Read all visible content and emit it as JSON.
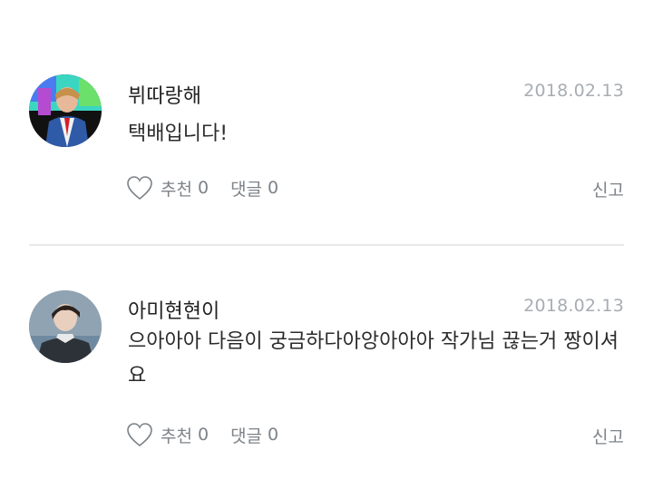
{
  "comments": [
    {
      "username": "뷔따랑해",
      "date": "2018.02.13",
      "text": "택배입니다!",
      "like_label": "추천",
      "like_count": "0",
      "reply_label": "댓글",
      "reply_count": "0",
      "report_label": "신고",
      "avatar_icon": "user-avatar-photo"
    },
    {
      "username": "아미현현이",
      "date": "2018.02.13",
      "text": "으아아아 다음이 궁금하다아앙아아아 작가님 끊는거 짱이셔요",
      "like_label": "추천",
      "like_count": "0",
      "reply_label": "댓글",
      "reply_count": "0",
      "report_label": "신고",
      "avatar_icon": "user-avatar-photo"
    }
  ],
  "colors": {
    "username": "#222222",
    "meta": "#a8adb3",
    "actions": "#7d8389",
    "divider": "#e6e8ea"
  }
}
